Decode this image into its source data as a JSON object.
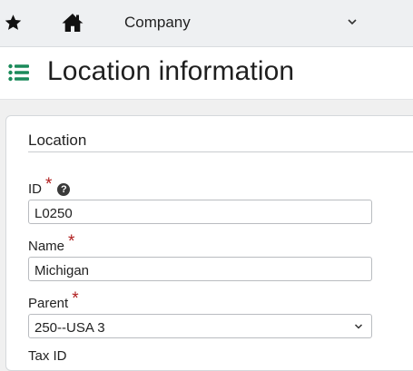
{
  "topbar": {
    "app_menu_label": "Company"
  },
  "page": {
    "title": "Location information"
  },
  "section": {
    "title": "Location"
  },
  "fields": {
    "id": {
      "label": "ID",
      "required_mark": "*",
      "help_glyph": "?",
      "value": "L0250"
    },
    "name": {
      "label": "Name",
      "required_mark": "*",
      "value": "Michigan"
    },
    "parent": {
      "label": "Parent",
      "required_mark": "*",
      "value": "250--USA 3"
    },
    "tax_id": {
      "label": "Tax ID"
    }
  },
  "colors": {
    "accent_green": "#1a8a5a",
    "required_red": "#b01e1e"
  },
  "icons": [
    "star-icon",
    "home-icon",
    "chevron-down-icon",
    "list-icon",
    "help-icon"
  ]
}
